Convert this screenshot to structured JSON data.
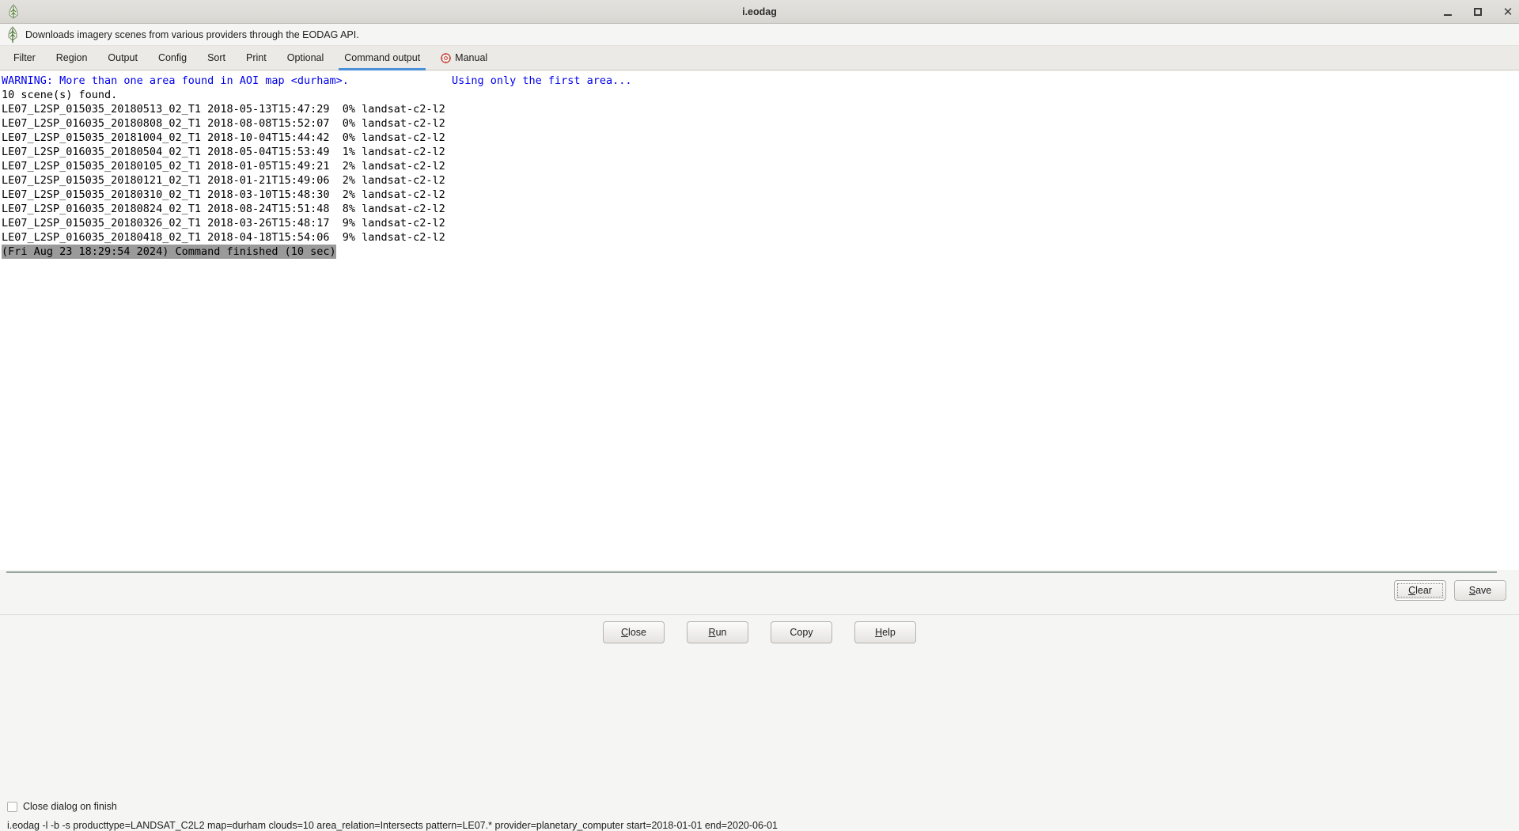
{
  "window": {
    "title": "i.eodag",
    "app_icon": "grass-leaf-icon",
    "controls": {
      "minimize": "minimize-icon",
      "maximize": "maximize-icon",
      "close": "close-icon"
    }
  },
  "description": {
    "icon": "grass-leaf-icon",
    "text": "Downloads imagery scenes from various providers through the EODAG API."
  },
  "tabs": [
    {
      "label": "Filter",
      "active": false
    },
    {
      "label": "Region",
      "active": false
    },
    {
      "label": "Output",
      "active": false
    },
    {
      "label": "Config",
      "active": false
    },
    {
      "label": "Sort",
      "active": false
    },
    {
      "label": "Print",
      "active": false
    },
    {
      "label": "Optional",
      "active": false
    },
    {
      "label": "Command output",
      "active": true
    },
    {
      "label": "Manual",
      "active": false,
      "icon": "help-manual-icon"
    }
  ],
  "output": {
    "lines": [
      {
        "kind": "warning",
        "text": "WARNING: More than one area found in AOI map <durham>.                Using only the first area..."
      },
      {
        "kind": "normal",
        "text": "10 scene(s) found."
      },
      {
        "kind": "normal",
        "text": "LE07_L2SP_015035_20180513_02_T1 2018-05-13T15:47:29  0% landsat-c2-l2"
      },
      {
        "kind": "normal",
        "text": "LE07_L2SP_016035_20180808_02_T1 2018-08-08T15:52:07  0% landsat-c2-l2"
      },
      {
        "kind": "normal",
        "text": "LE07_L2SP_015035_20181004_02_T1 2018-10-04T15:44:42  0% landsat-c2-l2"
      },
      {
        "kind": "normal",
        "text": "LE07_L2SP_016035_20180504_02_T1 2018-05-04T15:53:49  1% landsat-c2-l2"
      },
      {
        "kind": "normal",
        "text": "LE07_L2SP_015035_20180105_02_T1 2018-01-05T15:49:21  2% landsat-c2-l2"
      },
      {
        "kind": "normal",
        "text": "LE07_L2SP_015035_20180121_02_T1 2018-01-21T15:49:06  2% landsat-c2-l2"
      },
      {
        "kind": "normal",
        "text": "LE07_L2SP_015035_20180310_02_T1 2018-03-10T15:48:30  2% landsat-c2-l2"
      },
      {
        "kind": "normal",
        "text": "LE07_L2SP_016035_20180824_02_T1 2018-08-24T15:51:48  8% landsat-c2-l2"
      },
      {
        "kind": "normal",
        "text": "LE07_L2SP_015035_20180326_02_T1 2018-03-26T15:48:17  9% landsat-c2-l2"
      },
      {
        "kind": "normal",
        "text": "LE07_L2SP_016035_20180418_02_T1 2018-04-18T15:54:06  9% landsat-c2-l2"
      },
      {
        "kind": "finished",
        "text": "(Fri Aug 23 18:29:54 2024) Command finished (10 sec)"
      }
    ],
    "warning_color": "#0000ee",
    "finished_bg": "#9a9a9a"
  },
  "output_controls": {
    "clear": {
      "pre": "C",
      "post": "lear",
      "focused": true
    },
    "save": {
      "pre": "S",
      "post": "ave",
      "focused": false
    }
  },
  "actions": [
    {
      "pre": "C",
      "post": "lose"
    },
    {
      "pre": "R",
      "post": "un"
    },
    {
      "pre": "",
      "post": "Copy"
    },
    {
      "pre": "H",
      "post": "elp"
    }
  ],
  "footer": {
    "checkbox": {
      "label": "Close dialog on finish",
      "checked": false
    },
    "command": "i.eodag -l -b -s producttype=LANDSAT_C2L2 map=durham clouds=10 area_relation=Intersects pattern=LE07.* provider=planetary_computer start=2018-01-01 end=2020-06-01"
  }
}
